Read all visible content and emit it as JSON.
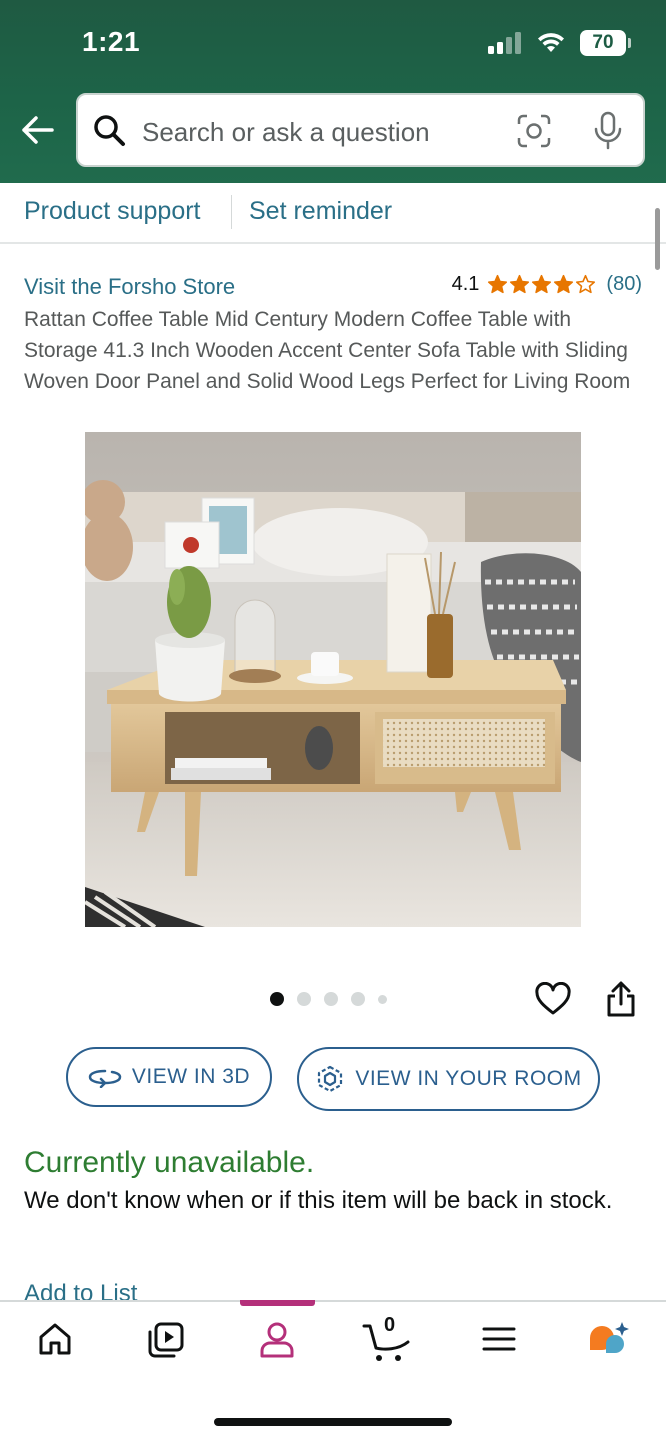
{
  "status_bar": {
    "time": "1:21",
    "battery": "70"
  },
  "search": {
    "placeholder": "Search or ask a question"
  },
  "subnav": {
    "product_support": "Product support",
    "set_reminder": "Set reminder"
  },
  "product": {
    "store_link": "Visit the Forsho Store",
    "rating": "4.1",
    "rating_stars": 4.1,
    "rating_count": "(80)",
    "title": "Rattan Coffee Table Mid Century Modern Coffee Table with Storage 41.3 Inch Wooden Accent Center Sofa Table with Sliding Woven Door Panel and Solid Wood Legs Perfect for Living Room",
    "image_count": 5,
    "active_image": 1
  },
  "buttons": {
    "view_3d": "VIEW IN 3D",
    "view_room": "VIEW IN YOUR ROOM"
  },
  "availability": {
    "status": "Currently unavailable.",
    "description": "We don't know when or if this item will be back in stock."
  },
  "add_to_list": "Add to List",
  "bottom_nav": {
    "cart_count": "0",
    "active_tab": "account"
  },
  "colors": {
    "header_green": "#1d6448",
    "link_blue": "#2a6f87",
    "button_blue": "#2b5f8e",
    "available_green": "#2e7d32",
    "star_orange": "#e77600",
    "active_tab_magenta": "#b4307a"
  }
}
